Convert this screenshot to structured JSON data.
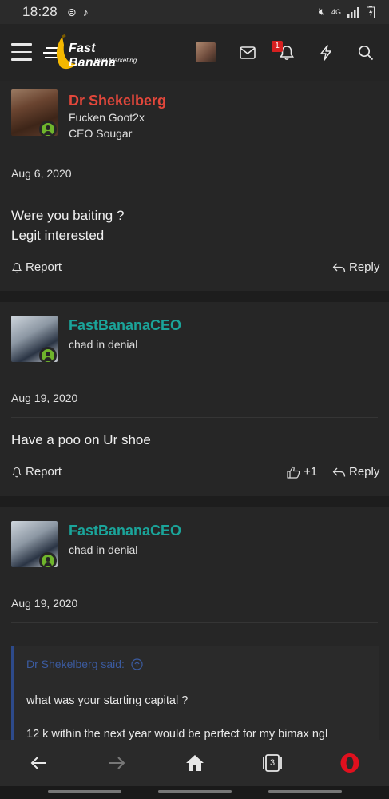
{
  "status_bar": {
    "time": "18:28",
    "network": "4G"
  },
  "header": {
    "brand_name": "Fast Banana",
    "brand_tagline": "Viral Marketing",
    "notification_count": "1"
  },
  "posts": [
    {
      "username": "Dr Shekelberg",
      "username_color": "#e2473b",
      "title_line1": "Fucken Goot2x",
      "title_line2": "CEO Sougar",
      "date": "Aug 6, 2020",
      "body_line1": "Were you baiting ?",
      "body_line2": "Legit interested",
      "report_label": "Report",
      "reply_label": "Reply"
    },
    {
      "username": "FastBananaCEO",
      "username_color": "#1ba49a",
      "title_line1": "chad in denial",
      "date": "Aug 19, 2020",
      "body_line1": "Have a poo on Ur shoe",
      "report_label": "Report",
      "like_count": "+1",
      "reply_label": "Reply"
    },
    {
      "username": "FastBananaCEO",
      "username_color": "#1ba49a",
      "title_line1": "chad in denial",
      "date": "Aug 19, 2020",
      "quote": {
        "header": "Dr Shekelberg said:",
        "line1": "what was your starting capital ?",
        "line2": "12 k within the next year would be perfect for my bimax ngl"
      }
    }
  ],
  "bottom_nav": {
    "tabs_count": "3"
  },
  "colors": {
    "accent_blue": "#2d4a8a",
    "online_green": "#6fb52c",
    "badge_red": "#d62020",
    "opera_red": "#e0101e"
  }
}
